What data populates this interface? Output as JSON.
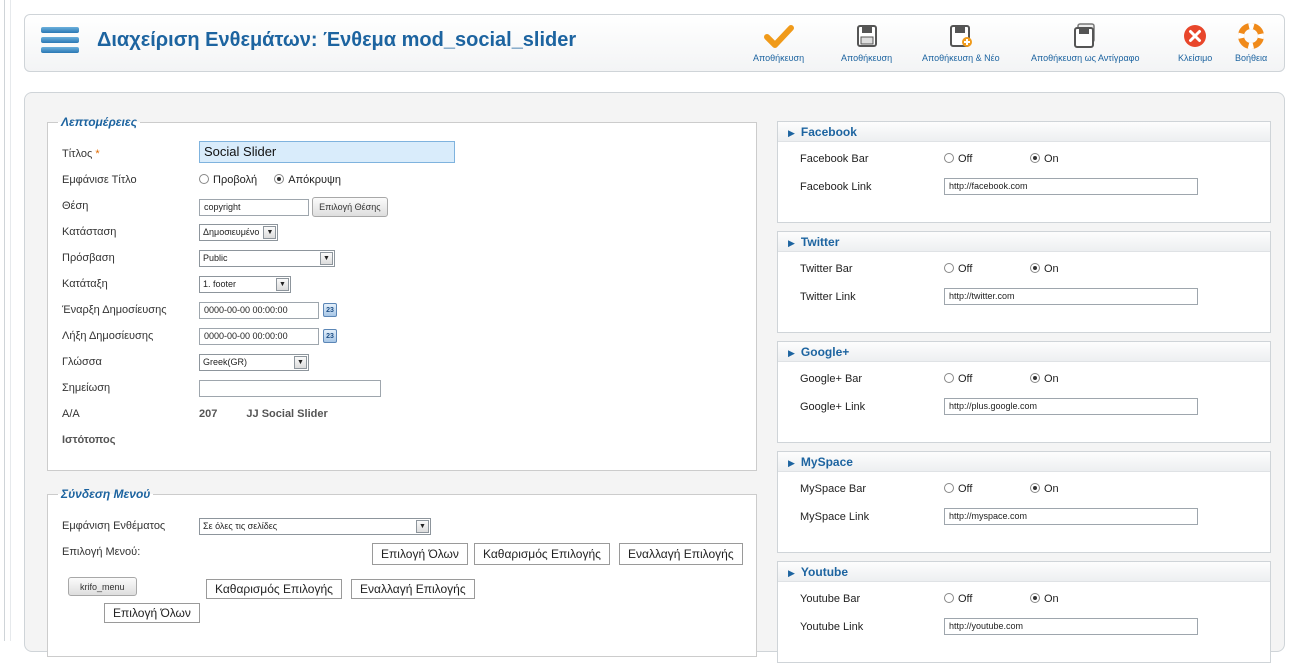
{
  "header": {
    "title": "Διαχείριση Ενθεμάτων: Ένθεμα mod_social_slider"
  },
  "toolbar": {
    "save": "Αποθήκευση",
    "apply": "Αποθήκευση",
    "save_new": "Αποθήκευση & Νέο",
    "save_copy": "Αποθήκευση ως Αντίγραφο",
    "close": "Κλείσιμο",
    "help": "Βοήθεια"
  },
  "details": {
    "legend": "Λεπτομέρειες",
    "title_label": "Τίτλος",
    "title_req": "*",
    "title_value": "Social Slider",
    "show_title_label": "Εμφάνισε Τίτλο",
    "show_opt": "Προβολή",
    "hide_opt": "Απόκρυψη",
    "position_label": "Θέση",
    "position_value": "copyright",
    "position_btn": "Επιλογή Θέσης",
    "status_label": "Κατάσταση",
    "status_value": "Δημοσιευμένο",
    "access_label": "Πρόσβαση",
    "access_value": "Public",
    "ordering_label": "Κατάταξη",
    "ordering_value": "1. footer",
    "start_label": "Έναρξη Δημοσίευσης",
    "start_value": "0000-00-00 00:00:00",
    "end_label": "Λήξη Δημοσίευσης",
    "end_value": "0000-00-00 00:00:00",
    "calendar_glyph": "23",
    "language_label": "Γλώσσα",
    "language_value": "Greek(GR)",
    "note_label": "Σημείωση",
    "note_value": "",
    "id_label": "Α/Α",
    "id_value": "207",
    "module_type": "JJ Social Slider",
    "site_label": "Ιστότοπος"
  },
  "menu_assign": {
    "legend": "Σύνδεση Μενού",
    "display_label": "Εμφάνιση Ενθέματος",
    "display_value": "Σε όλες τις σελίδες",
    "select_label": "Επιλογή Μενού:",
    "select_all": "Επιλογή Όλων",
    "clear": "Καθαρισμός Επιλογής",
    "toggle": "Εναλλαγή Επιλογής",
    "menu_name": "krifo_menu",
    "menu_clear": "Καθαρισμός Επιλογής",
    "menu_toggle": "Εναλλαγή Επιλογής",
    "menu_select_all": "Επιλογή Όλων"
  },
  "social": {
    "off": "Off",
    "on": "On",
    "panels": [
      {
        "title": "Facebook",
        "bar_label": "Facebook Bar",
        "link_label": "Facebook Link",
        "link_value": "http://facebook.com"
      },
      {
        "title": "Twitter",
        "bar_label": "Twitter Bar",
        "link_label": "Twitter Link",
        "link_value": "http://twitter.com"
      },
      {
        "title": "Google+",
        "bar_label": "Google+ Bar",
        "link_label": "Google+ Link",
        "link_value": "http://plus.google.com"
      },
      {
        "title": "MySpace",
        "bar_label": "MySpace Bar",
        "link_label": "MySpace Link",
        "link_value": "http://myspace.com"
      },
      {
        "title": "Youtube",
        "bar_label": "Youtube Bar",
        "link_label": "Youtube Link",
        "link_value": "http://youtube.com"
      }
    ]
  }
}
